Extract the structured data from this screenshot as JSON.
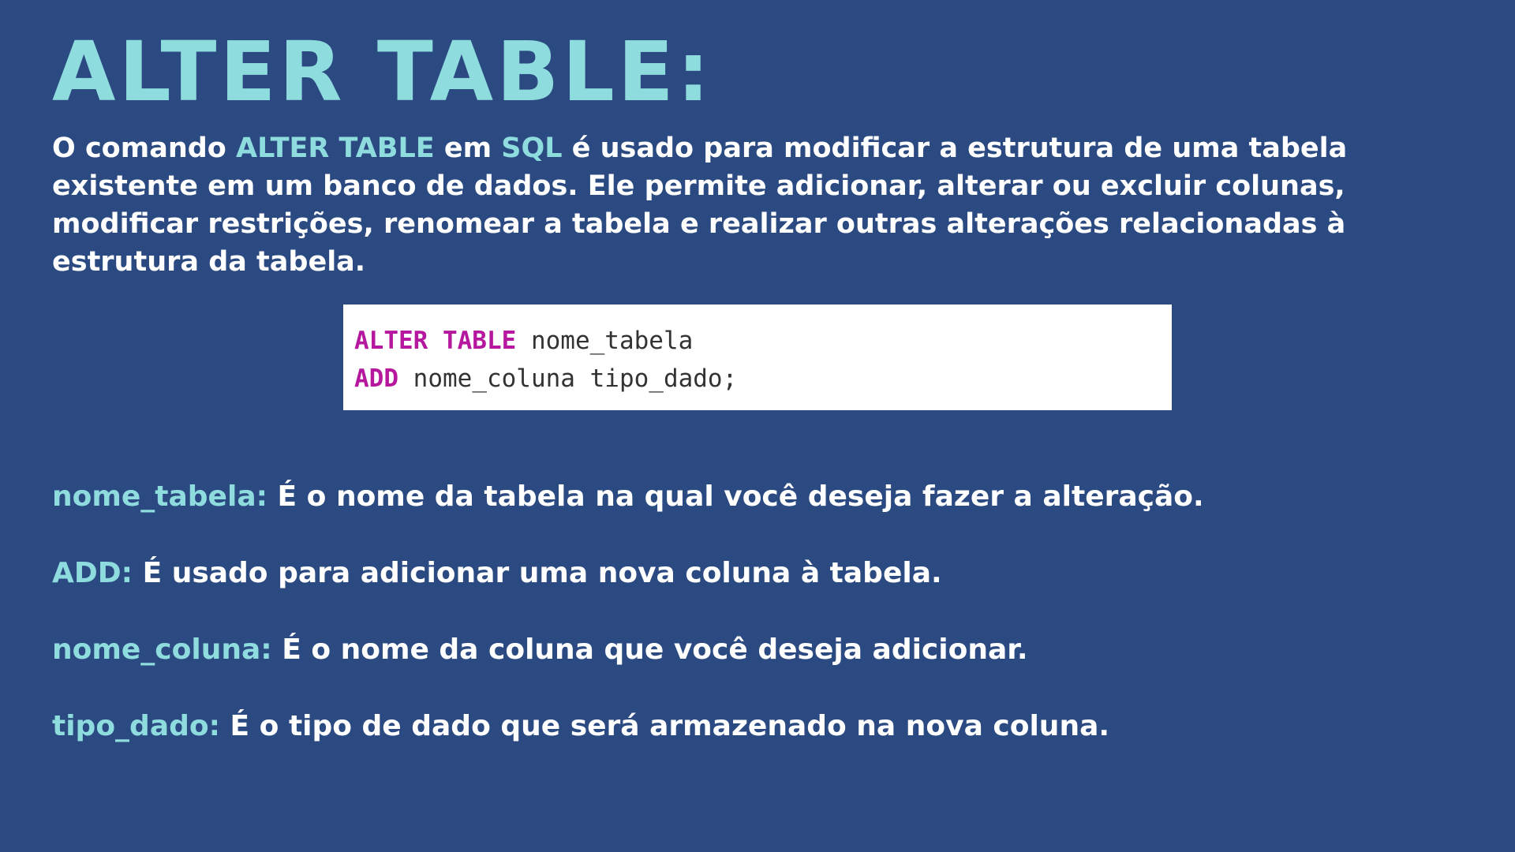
{
  "title": "ALTER TABLE:",
  "intro": {
    "p1": "O comando ",
    "hl1": "ALTER TABLE",
    "p2": " em ",
    "hl2": "SQL",
    "p3": " é usado para modificar a estrutura de uma tabela existente em um banco de dados. Ele permite adicionar, alterar ou excluir colunas, modificar restrições, renomear a tabela e realizar outras alterações relacionadas à estrutura da tabela."
  },
  "code": {
    "line1_kw": "ALTER TABLE",
    "line1_rest": " nome_tabela",
    "line2_kw": "ADD",
    "line2_rest": " nome_coluna tipo_dado;"
  },
  "definitions": [
    {
      "term": "nome_tabela:",
      "text": " É o nome da tabela na qual você deseja fazer a alteração."
    },
    {
      "term": "ADD:",
      "text": " É usado para adicionar uma nova coluna à tabela."
    },
    {
      "term": "nome_coluna:",
      "text": " É o nome da coluna que você deseja adicionar."
    },
    {
      "term": "tipo_dado:",
      "text": " É o tipo de dado que será armazenado na nova coluna."
    }
  ],
  "colors": {
    "background": "#2c4a82",
    "accent": "#8fdcdf",
    "text": "#ffffff",
    "code_keyword": "#b5179e"
  }
}
